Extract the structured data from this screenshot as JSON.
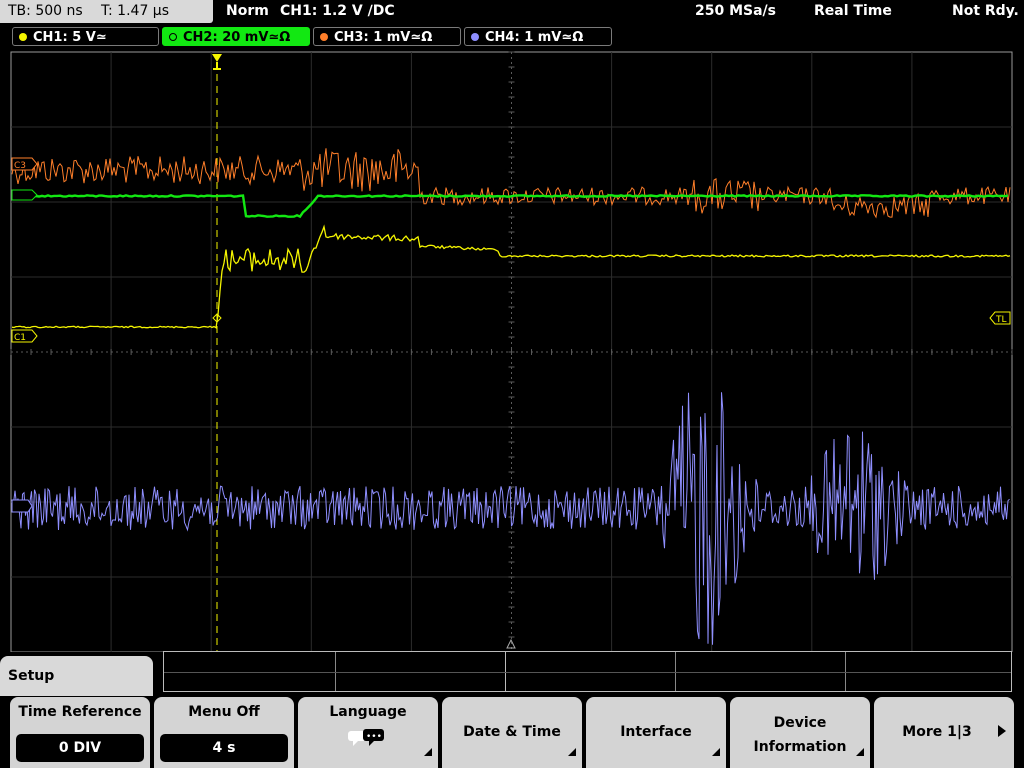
{
  "status": {
    "timebase": "TB: 500 ns",
    "trigger_time": "T: 1.47 µs",
    "mode": "Norm",
    "trigger": "CH1: 1.2 V ∕DC",
    "sample_rate": "250 MSa/s",
    "acq_mode": "Real Time",
    "state": "Not Rdy."
  },
  "channels": [
    {
      "label": "CH1: 5 V≃",
      "color": "#f5f500"
    },
    {
      "label": "CH2: 20 mV≃Ω",
      "color": "#12e812"
    },
    {
      "label": "CH3: 1 mV≃Ω",
      "color": "#ff7f2a"
    },
    {
      "label": "CH4: 1 mV≃Ω",
      "color": "#8f8fff"
    }
  ],
  "markers": {
    "c3": "C3",
    "c1": "C1",
    "trigger_level": "TL"
  },
  "menu": {
    "title": "Setup",
    "softkeys": [
      {
        "label": "Time Reference",
        "value": "0 DIV"
      },
      {
        "label": "Menu Off",
        "value": "4 s"
      },
      {
        "label": "Language",
        "icon": "speech-bubble-icon"
      },
      {
        "label": "Date & Time"
      },
      {
        "label": "Interface"
      },
      {
        "label": "Device Information"
      },
      {
        "label": "More 1|3"
      }
    ]
  }
}
